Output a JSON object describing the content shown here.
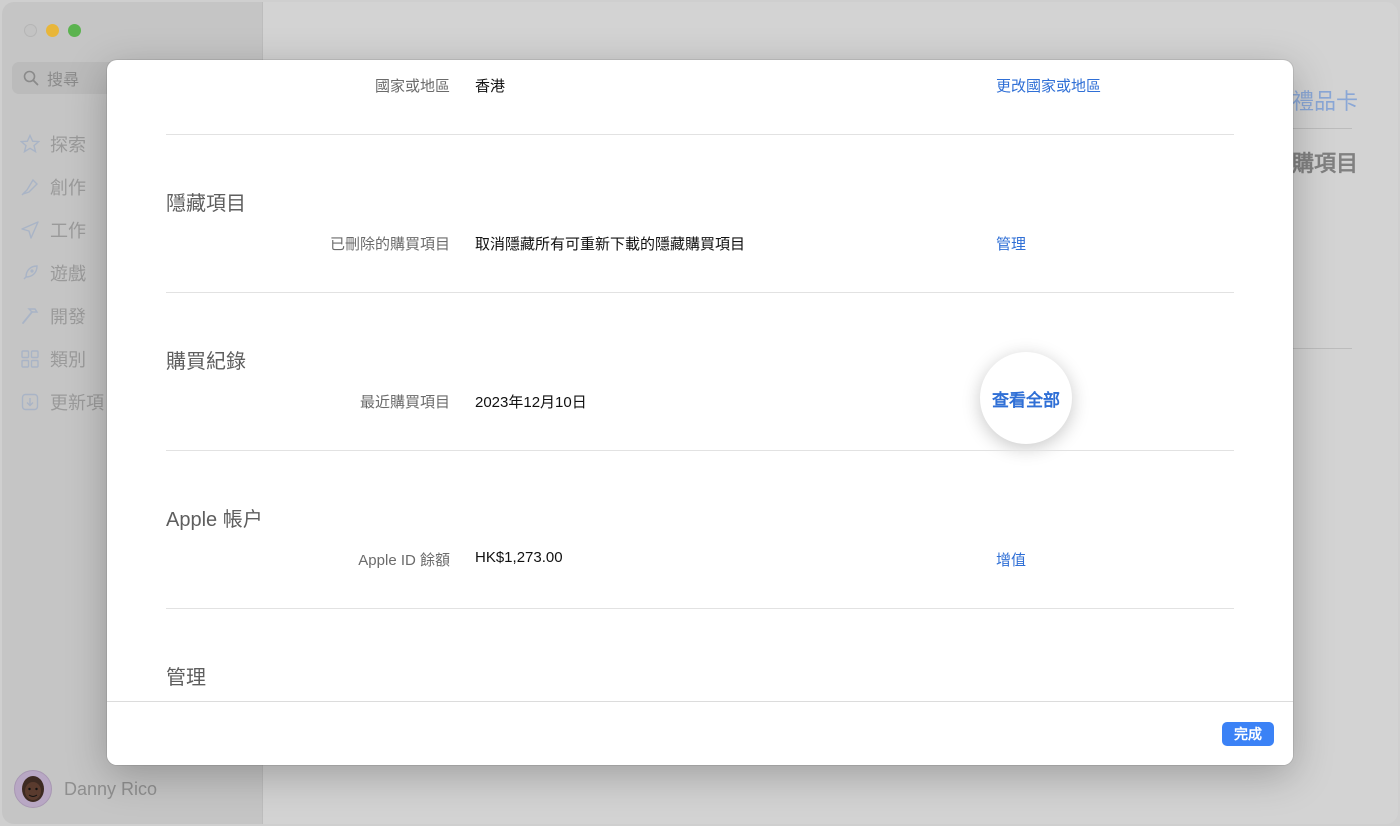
{
  "sidebar": {
    "search_placeholder": "搜尋",
    "items": [
      {
        "label": "探索",
        "icon": "star-icon"
      },
      {
        "label": "創作",
        "icon": "brush-icon"
      },
      {
        "label": "工作",
        "icon": "paperplane-icon"
      },
      {
        "label": "遊戲",
        "icon": "rocket-icon"
      },
      {
        "label": "開發",
        "icon": "hammer-icon"
      },
      {
        "label": "類別",
        "icon": "grid-icon"
      },
      {
        "label": "更新項",
        "icon": "download-icon"
      }
    ],
    "user_name": "Danny Rico"
  },
  "background": {
    "peek_title": "禮品卡",
    "peek_subtitle": "購項目"
  },
  "sheet": {
    "country_row": {
      "label": "國家或地區",
      "value": "香港",
      "action": "更改國家或地區"
    },
    "hidden_section": {
      "title": "隱藏項目",
      "row": {
        "label": "已刪除的購買項目",
        "value": "取消隱藏所有可重新下載的隱藏購買項目",
        "action": "管理"
      }
    },
    "purchase_section": {
      "title": "購買紀錄",
      "row": {
        "label": "最近購買項目",
        "value": "2023年12月10日",
        "action": "查看全部"
      }
    },
    "account_section": {
      "title": "Apple 帳户",
      "row": {
        "label": "Apple ID 餘額",
        "value": "HK$1,273.00",
        "action": "增值"
      }
    },
    "manage_section": {
      "title": "管理"
    },
    "done_label": "完成"
  }
}
